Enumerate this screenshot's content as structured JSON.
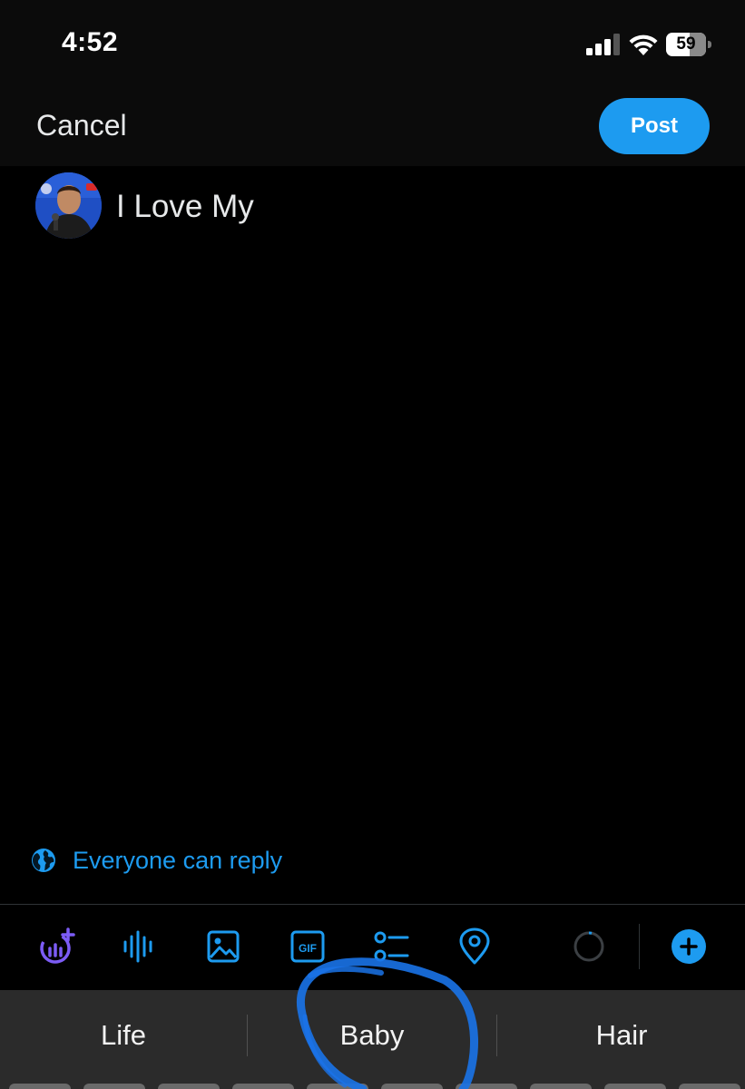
{
  "status_bar": {
    "time": "4:52",
    "battery": "59"
  },
  "header": {
    "cancel_label": "Cancel",
    "post_label": "Post"
  },
  "compose": {
    "text": "I Love My"
  },
  "reply_setting": {
    "label": "Everyone can reply",
    "icon": "globe-icon"
  },
  "toolbar": {
    "icons": [
      "grok-icon",
      "voice-wave-icon",
      "image-icon",
      "gif-icon",
      "poll-icon",
      "location-pin-icon",
      "character-counter-icon",
      "add-thread-icon"
    ],
    "gif_label": "GIF"
  },
  "keyboard": {
    "suggestions": [
      "Life",
      "Baby",
      "Hair"
    ]
  },
  "colors": {
    "accent": "#1d9bf0",
    "grok_purple": "#7c5cf5",
    "background": "#000000",
    "bar_background": "#0b0b0b",
    "keyboard_background": "#2b2b2b"
  }
}
